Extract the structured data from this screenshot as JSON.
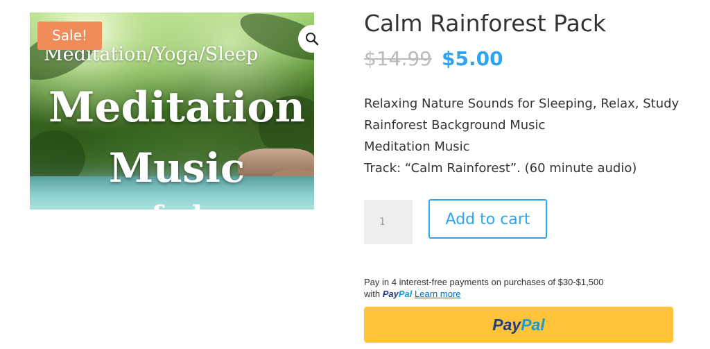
{
  "product": {
    "image": {
      "alt_subtitle": "Meditation/Yoga/Sleep",
      "title_line1": "Meditation",
      "title_line2": "Music",
      "title_line3": "f       ·     l"
    },
    "sale_badge": "Sale!",
    "zoom_icon": "magnifier-icon",
    "title": "Calm Rainforest Pack",
    "price_regular": "$14.99",
    "price_sale": "$5.00",
    "description_lines": [
      "Relaxing Nature Sounds for Sleeping, Relax, Study",
      "Rainforest Background Music",
      "Meditation Music",
      "Track: “Calm Rainforest”. (60 minute audio)"
    ],
    "quantity": "1",
    "add_to_cart_label": "Add to cart"
  },
  "paypal": {
    "pay_later_text": "Pay in 4 interest-free payments on purchases of $30-$1,500",
    "with_text": "with",
    "wordmark_pay": "Pay",
    "wordmark_pal": "Pal",
    "learn_more": "Learn more",
    "button_pay": "Pay",
    "button_pal": "Pal"
  },
  "colors": {
    "accent": "#2ea3f2",
    "sale_badge": "#ef8c5a",
    "paypal_button": "#ffc439",
    "paypal_dark": "#253b80",
    "paypal_light": "#179bd7"
  }
}
